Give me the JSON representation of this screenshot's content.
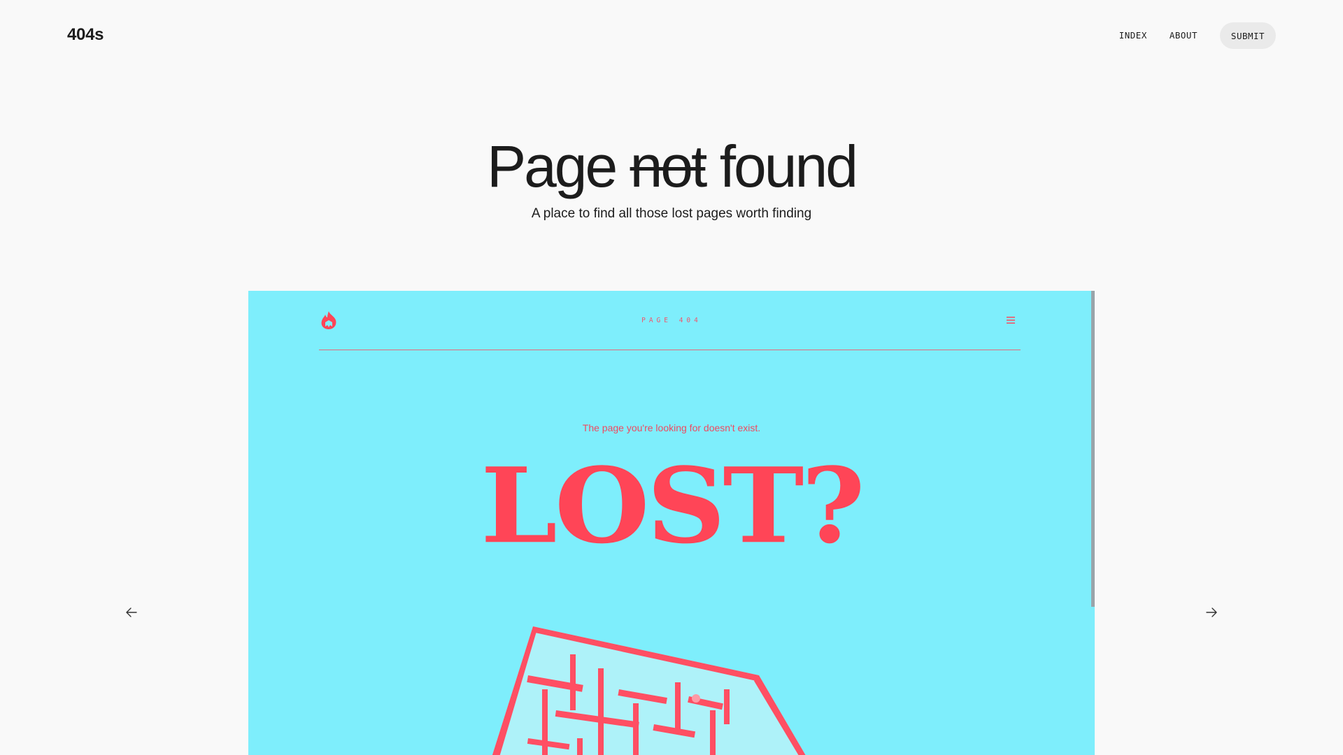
{
  "site": {
    "logo": "404s"
  },
  "nav": {
    "links": [
      "INDEX",
      "ABOUT"
    ],
    "submit_label": "SUBMIT"
  },
  "hero": {
    "title_before": "Page",
    "title_strike": "not",
    "title_after": "found",
    "subtitle": "A place to find all those lost pages worth finding"
  },
  "carousel": {
    "prev_icon": "arrow-left-icon",
    "next_icon": "arrow-right-icon",
    "slide": {
      "background_color": "#7eeefc",
      "accent_color": "#ff4557",
      "brand_icon": "flame-logo-icon",
      "header_title": "PAGE 404",
      "menu_icon": "hamburger-menu-icon",
      "message": "The page you're looking for doesn't exist.",
      "headline": "LOST?",
      "illustration": "3d-maze-illustration"
    }
  }
}
